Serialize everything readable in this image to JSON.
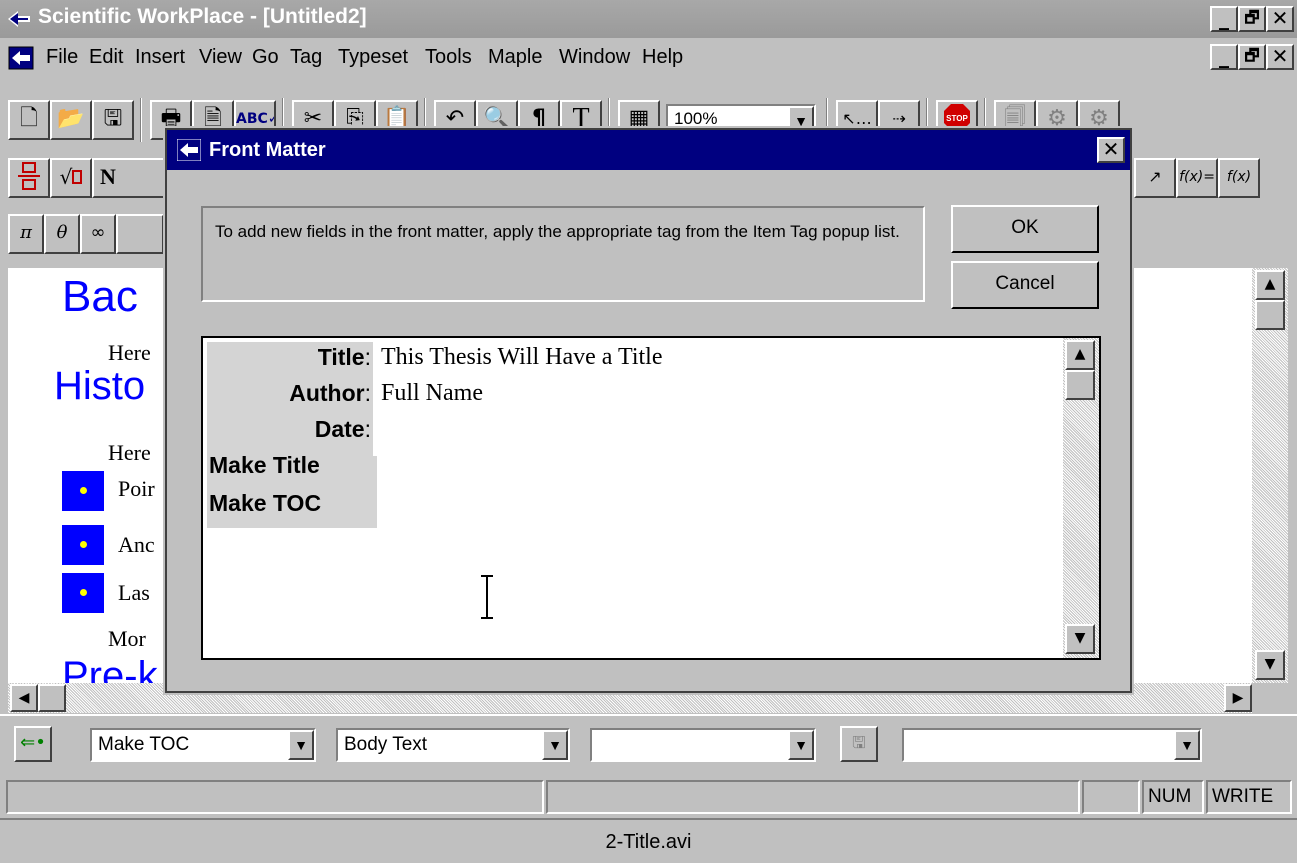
{
  "window": {
    "title": "Scientific WorkPlace - [Untitled2]"
  },
  "menu": [
    "File",
    "Edit",
    "Insert",
    "View",
    "Go",
    "Tag",
    "Typeset",
    "Tools",
    "Maple",
    "Window",
    "Help"
  ],
  "toolbar": {
    "zoom": "100%"
  },
  "symbols": {
    "pi": "π",
    "theta": "θ",
    "infinity": "∞"
  },
  "document": {
    "heading1": "Bac",
    "para1": "Here",
    "heading2": "Histo",
    "para2": "Here",
    "bullets": [
      "Poir",
      "Anc",
      "Las"
    ],
    "para3": "Mor",
    "heading3": "Pre-k"
  },
  "dialog": {
    "title": "Front Matter",
    "instructions": "To add new fields in the front matter, apply the appropriate tag from the Item Tag popup list.",
    "ok_label": "OK",
    "cancel_label": "Cancel",
    "fields": [
      {
        "label": "Title",
        "suffix": ":",
        "value": "This Thesis Will Have a Title"
      },
      {
        "label": "Author",
        "suffix": ":",
        "value": "Full Name"
      },
      {
        "label": "Date",
        "suffix": ":",
        "value": ""
      },
      {
        "label": "Make Title",
        "suffix": "",
        "value": ""
      },
      {
        "label": "Make TOC",
        "suffix": "",
        "value": ""
      }
    ]
  },
  "tagbar": {
    "item_tag": "Make TOC",
    "body_tag": "Body Text",
    "section_tag": "",
    "text_tag": ""
  },
  "statusbar": {
    "num": "NUM",
    "write": "WRITE"
  },
  "caption": "2-Title.avi"
}
